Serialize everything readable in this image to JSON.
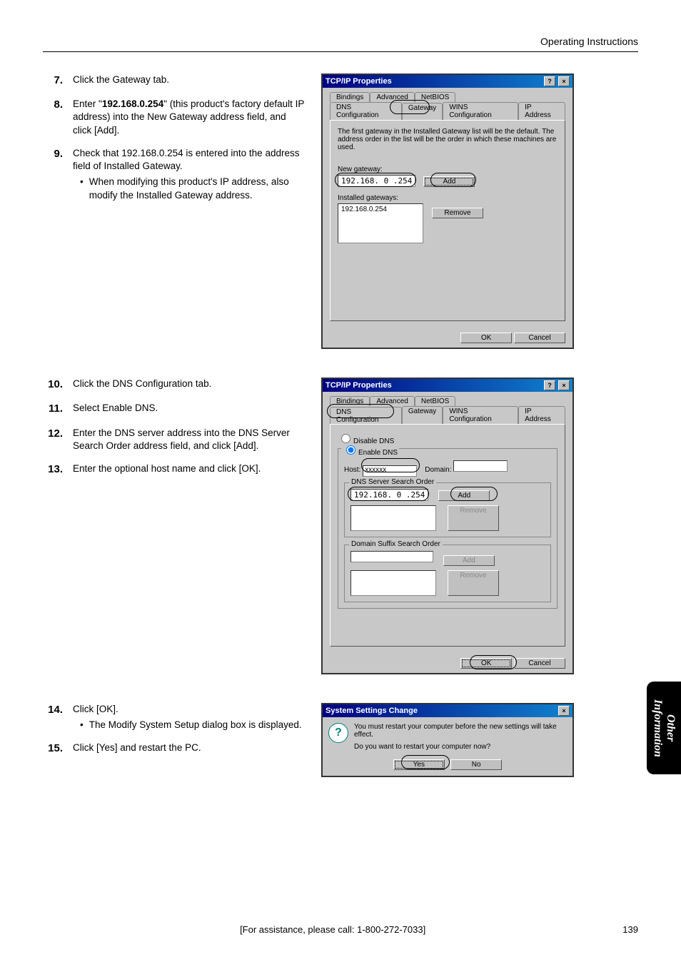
{
  "header": {
    "section": "Operating Instructions"
  },
  "side_tab": {
    "line1": "Other",
    "line2": "Information"
  },
  "footer": {
    "assist": "[For assistance, please call: 1-800-272-7033]",
    "page": "139"
  },
  "steps": {
    "s7": {
      "num": "7.",
      "text": "Click the Gateway tab."
    },
    "s8": {
      "num": "8.",
      "prefix": "Enter \"",
      "ip": "192.168.0.254",
      "suffix": "\" (this product's factory default IP address) into the New Gateway address field, and click [Add]."
    },
    "s9": {
      "num": "9.",
      "text": "Check that 192.168.0.254 is entered into the address field of Installed Gateway.",
      "bullet": "When modifying this product's IP address, also modify the Installed Gateway address."
    },
    "s10": {
      "num": "10.",
      "text": "Click the DNS Configuration tab."
    },
    "s11": {
      "num": "11.",
      "text": "Select Enable DNS."
    },
    "s12": {
      "num": "12.",
      "text": "Enter the DNS server address into the DNS Server Search Order address field, and click [Add]."
    },
    "s13": {
      "num": "13.",
      "text": "Enter the optional host name and click [OK]."
    },
    "s14": {
      "num": "14.",
      "text": "Click [OK].",
      "bullet": "The Modify System Setup dialog box is displayed."
    },
    "s15": {
      "num": "15.",
      "text": "Click [Yes] and restart the PC."
    }
  },
  "dialog1": {
    "title": "TCP/IP Properties",
    "tabs_top": [
      "Bindings",
      "Advanced",
      "NetBIOS"
    ],
    "tabs_bottom": [
      "DNS Configuration",
      "Gateway",
      "WINS Configuration",
      "IP Address"
    ],
    "desc": "The first gateway in the Installed Gateway list will be the default. The address order in the list will be the order in which these machines are used.",
    "new_gateway_label": "New gateway:",
    "new_gateway_value": "192.168. 0 .254",
    "add_btn": "Add",
    "installed_label": "Installed gateways:",
    "installed_value": "192.168.0.254",
    "remove_btn": "Remove",
    "ok": "OK",
    "cancel": "Cancel"
  },
  "dialog2": {
    "title": "TCP/IP Properties",
    "tabs_top": [
      "Bindings",
      "Advanced",
      "NetBIOS"
    ],
    "tabs_bottom": [
      "DNS Configuration",
      "Gateway",
      "WINS Configuration",
      "IP Address"
    ],
    "disable_dns": "Disable DNS",
    "enable_dns": "Enable DNS",
    "host_label": "Host:",
    "host_value": "xxxxxx",
    "domain_label": "Domain:",
    "dns_order_label": "DNS Server Search Order",
    "dns_value": "192.168. 0 .254",
    "add_btn": "Add",
    "remove_btn": "Remove",
    "suffix_label": "Domain Suffix Search Order",
    "add2": "Add",
    "remove2": "Remove",
    "ok": "OK",
    "cancel": "Cancel"
  },
  "msgbox": {
    "title": "System Settings Change",
    "line1": "You must restart your computer before the new settings will take effect.",
    "line2": "Do you want to restart your computer now?",
    "yes": "Yes",
    "no": "No"
  }
}
